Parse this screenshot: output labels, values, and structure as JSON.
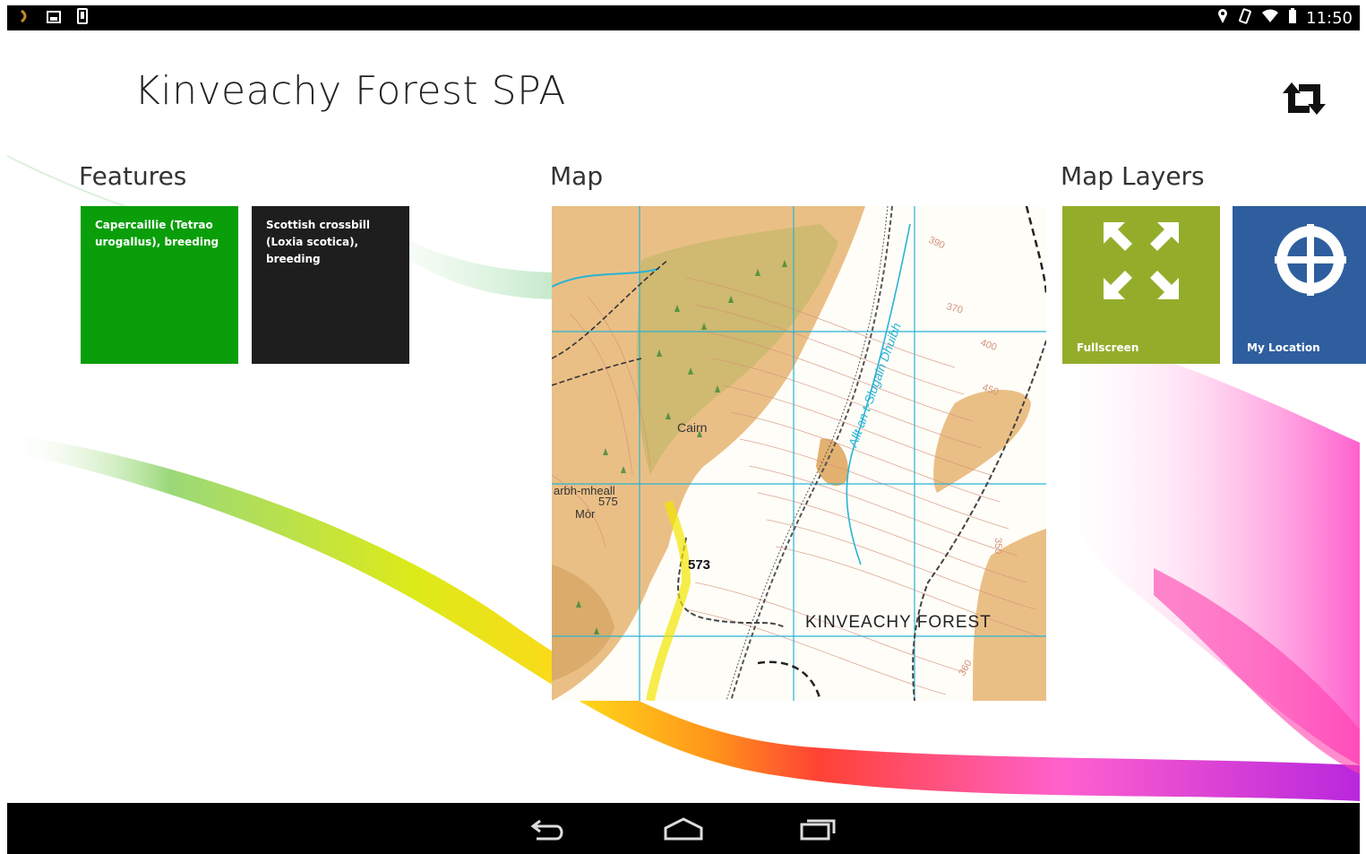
{
  "status_bar": {
    "time": "11:50",
    "left_icons": [
      "notification-icon",
      "image-icon",
      "phone-icon"
    ],
    "right_icons": [
      "location-icon",
      "rotate-icon",
      "wifi-icon",
      "battery-icon"
    ]
  },
  "header": {
    "title": "Kinveachy Forest SPA",
    "sync_icon": "sync-arrows-icon"
  },
  "sections": {
    "features_label": "Features",
    "map_label": "Map",
    "layers_label": "Map Layers"
  },
  "features": [
    {
      "label": "Capercaillie (Tetrao urogallus), breeding",
      "color": "#0a9e0a"
    },
    {
      "label": "Scottish crossbill (Loxia scotica), breeding",
      "color": "#1e1e1e"
    }
  ],
  "map": {
    "labels": {
      "cairn": "Cairn",
      "hill_name_1": "arbh-mheall",
      "hill_name_2": "Mòr",
      "spot_575": "575",
      "spot_573": "573",
      "forest": "KINVEACHY  FOREST",
      "stream": "Allt an t-Slugain Dhuibh",
      "c390": "390",
      "c370": "370",
      "c400": "400",
      "c450": "450",
      "c350": "350",
      "c360": "360"
    }
  },
  "map_layers": [
    {
      "label": "Fullscreen",
      "icon": "fullscreen-icon",
      "color": "#93ad2b"
    },
    {
      "label": "My Location",
      "icon": "crosshair-icon",
      "color": "#2e5e9e"
    }
  ],
  "nav_bar": {
    "icons": [
      "back-icon",
      "home-icon",
      "recents-icon"
    ]
  }
}
